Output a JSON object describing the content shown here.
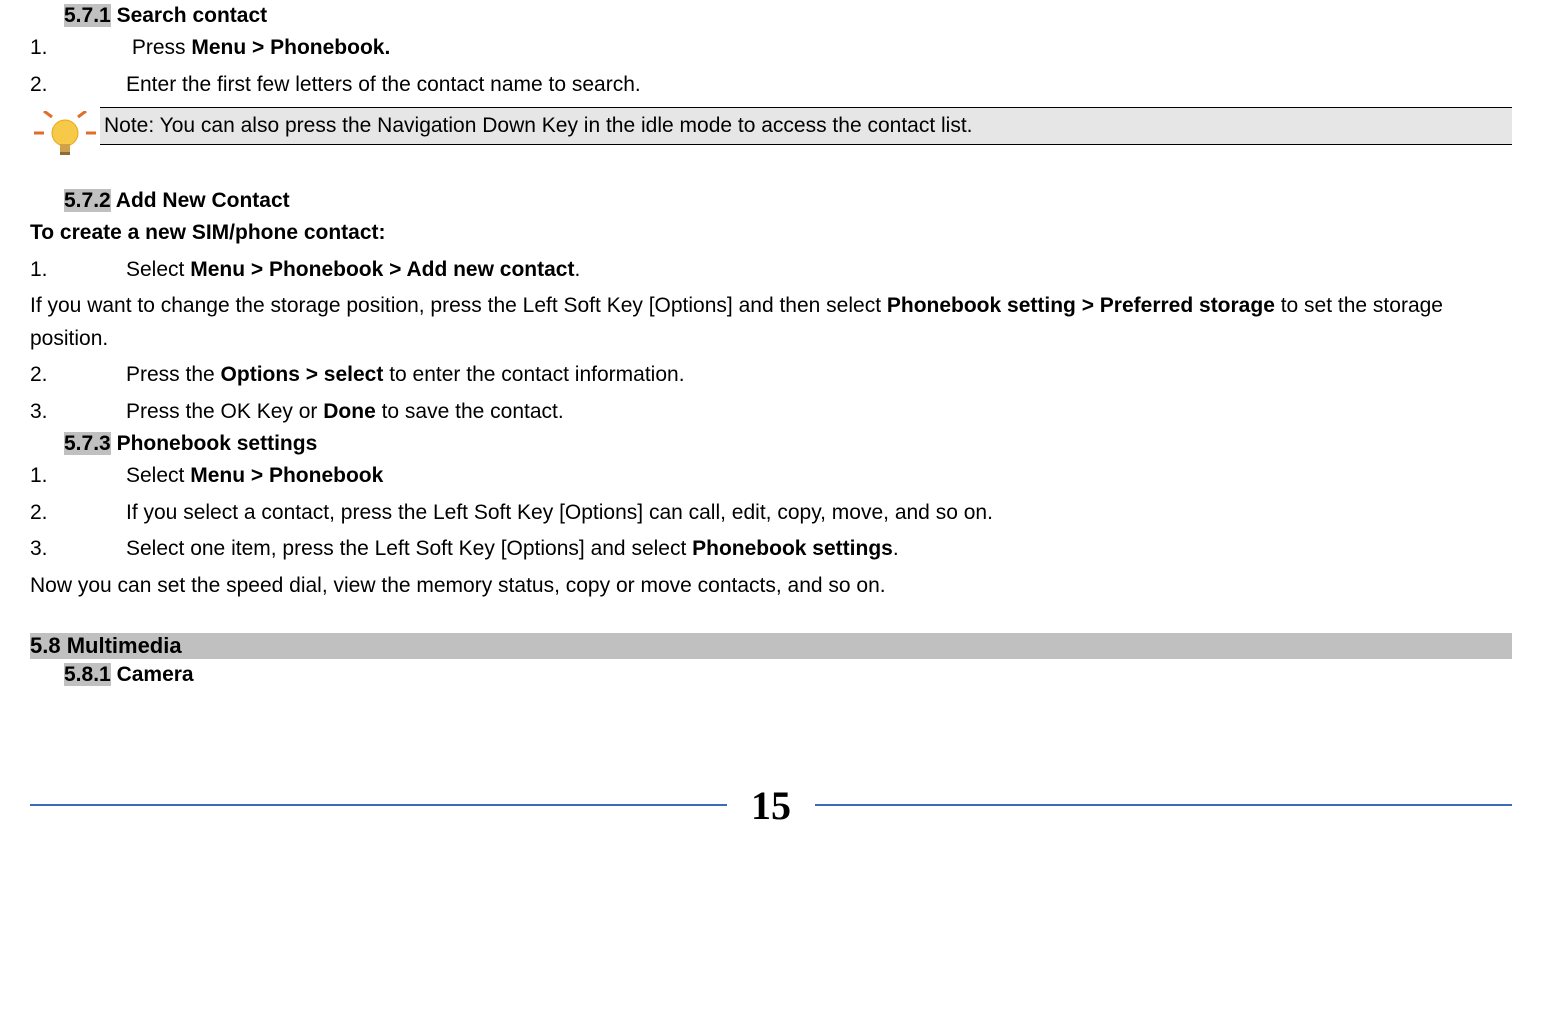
{
  "s571": {
    "num": "5.7.1",
    "title": "Search contact",
    "step1_num": "1.",
    "step1_a": " Press ",
    "step1_b": "Menu > Phonebook.",
    "step2_num": "2.",
    "step2": "Enter the first few letters of the contact name to search.",
    "note": "Note: You can also press the Navigation Down Key in the idle mode to access the contact list."
  },
  "s572": {
    "num": "5.7.2",
    "title": "Add New Contact",
    "intro": "To create a new SIM/phone contact:",
    "step1_num": "1.",
    "step1_a": "Select ",
    "step1_b": "Menu > Phonebook > Add new contact",
    "step1_c": ".",
    "para_a": "If you want to change the storage position, press the Left Soft Key [Options] and then select ",
    "para_b": "Phonebook setting > Preferred storage",
    "para_c": " to set the storage position.",
    "step2_num": "2.",
    "step2_a": "Press the ",
    "step2_b": "Options > select",
    "step2_c": " to enter the contact information.",
    "step3_num": "3.",
    "step3_a": "Press the OK Key or ",
    "step3_b": "Done",
    "step3_c": " to save the contact."
  },
  "s573": {
    "num": "5.7.3",
    "title": "Phonebook settings",
    "step1_num": "1.",
    "step1_a": "Select ",
    "step1_b": "Menu > Phonebook",
    "step2_num": "2.",
    "step2": "If you select a contact, press the Left Soft Key [Options] can call, edit, copy, move, and so on.",
    "step3_num": "3.",
    "step3_a": "Select one item, press the Left Soft Key [Options] and select ",
    "step3_b": "Phonebook settings",
    "step3_c": ".",
    "closing": "Now you can set the speed dial, view the memory status, copy or move contacts, and so on."
  },
  "s58": {
    "num_title": "5.8 Multimedia"
  },
  "s581": {
    "num": "5.8.1",
    "title": "Camera"
  },
  "page_number": "15"
}
